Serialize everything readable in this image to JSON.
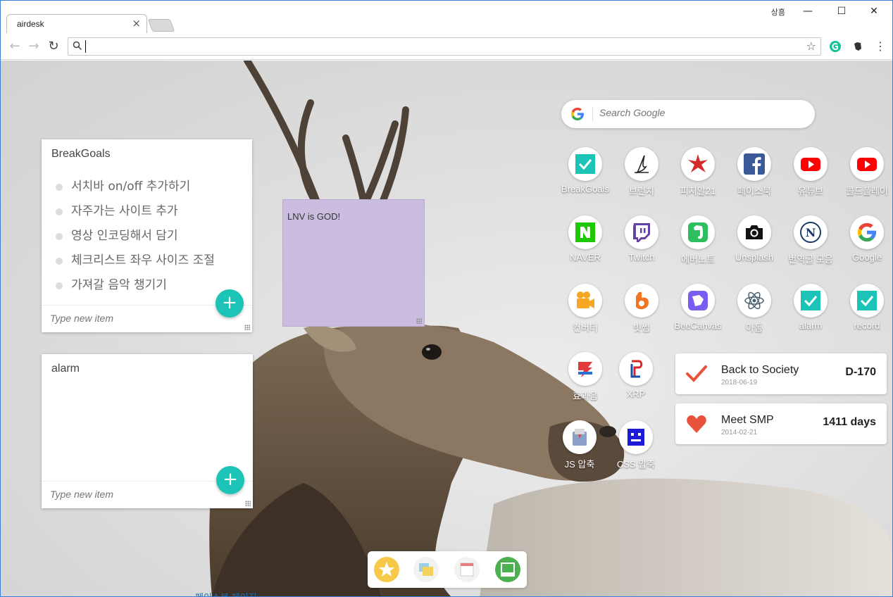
{
  "browser": {
    "tab_title": "airdesk",
    "tab_close": "×",
    "profile_name": "상흠",
    "minimize": "—",
    "maximize": "☐",
    "close": "✕",
    "omnibox_value": ""
  },
  "notes": {
    "breakgoals": {
      "title": "BreakGoals",
      "items": [
        "서치바 on/off 추가하기",
        "자주가는 사이트 추가",
        "영상 인코딩해서 담기",
        "체크리스트 좌우 사이즈 조절",
        "가져갈 음악 챙기기"
      ],
      "placeholder": "Type new item"
    },
    "alarm": {
      "title": "alarm",
      "placeholder": "Type new item"
    }
  },
  "sticky": {
    "text": "LNV is GOD!"
  },
  "search": {
    "placeholder": "Search Google"
  },
  "shortcuts": [
    {
      "label": "BreakGoals",
      "icon": "check-icon"
    },
    {
      "label": "브런치",
      "icon": "brunch-icon"
    },
    {
      "label": "피지알21",
      "icon": "pgr-icon"
    },
    {
      "label": "페이스북",
      "icon": "facebook-icon"
    },
    {
      "label": "유튜브",
      "icon": "youtube-icon"
    },
    {
      "label": "콜드플레이",
      "icon": "youtube-icon"
    },
    {
      "label": "NAVER",
      "icon": "naver-icon"
    },
    {
      "label": "Twitch",
      "icon": "twitch-icon"
    },
    {
      "label": "에버노트",
      "icon": "evernote-icon"
    },
    {
      "label": "Unsplash",
      "icon": "camera-icon"
    },
    {
      "label": "번역글 모음",
      "icon": "n-icon"
    },
    {
      "label": "Google",
      "icon": "google-icon"
    },
    {
      "label": "컨버터",
      "icon": "converter-icon"
    },
    {
      "label": "빗썸",
      "icon": "bithumb-icon"
    },
    {
      "label": "BeeCanvas",
      "icon": "beecanvas-icon"
    },
    {
      "label": "아톰",
      "icon": "atom-icon"
    },
    {
      "label": "alarm",
      "icon": "check-icon"
    },
    {
      "label": "record",
      "icon": "check-icon"
    },
    {
      "label": "효과음",
      "icon": "sound-icon"
    },
    {
      "label": "XRP",
      "icon": "xrp-icon"
    },
    {
      "label": "JS 압축",
      "icon": "js-compress-icon"
    },
    {
      "label": "CSS 압축",
      "icon": "css-compress-icon"
    }
  ],
  "ddays": [
    {
      "title": "Back to Society",
      "date": "2018-06-19",
      "value": "D-170",
      "icon": "check-icon",
      "color": "#e8523a"
    },
    {
      "title": "Meet SMP",
      "date": "2014-02-21",
      "value": "1411 days",
      "icon": "heart-icon",
      "color": "#e8523a"
    }
  ],
  "dock": [
    "star-icon",
    "notes-icon",
    "calendar-icon",
    "board-icon"
  ],
  "bottom_text": "페이스북 페이지",
  "colors": {
    "accent": "#1cc4b8",
    "sticky": "#cbbde0",
    "dday_red": "#e8523a"
  }
}
